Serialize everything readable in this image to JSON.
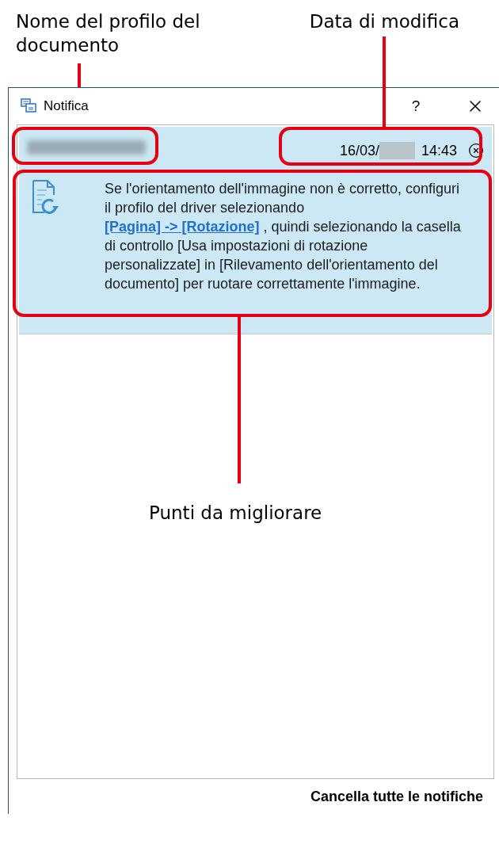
{
  "annotations": {
    "profile_name": "Nome del profilo del documento",
    "modified_date": "Data di modifica",
    "improvements": "Punti da migliorare"
  },
  "window": {
    "title": "Notifica",
    "help": "?"
  },
  "notifications": [
    {
      "date": "16/03/",
      "time": "14:43",
      "message_before": "Se l'orientamento dell'immagine non è corretto, configuri il profilo del driver selezionando",
      "link": "[Pagina] -> [Rotazione]",
      "message_after": ", quindi selezionando la casella di controllo [Usa impostazioni di rotazione personalizzate] in [Rilevamento dell'orientamento del documento] per ruotare correttamente l'immagine."
    }
  ],
  "clear_all": "Cancella tutte le notifiche"
}
